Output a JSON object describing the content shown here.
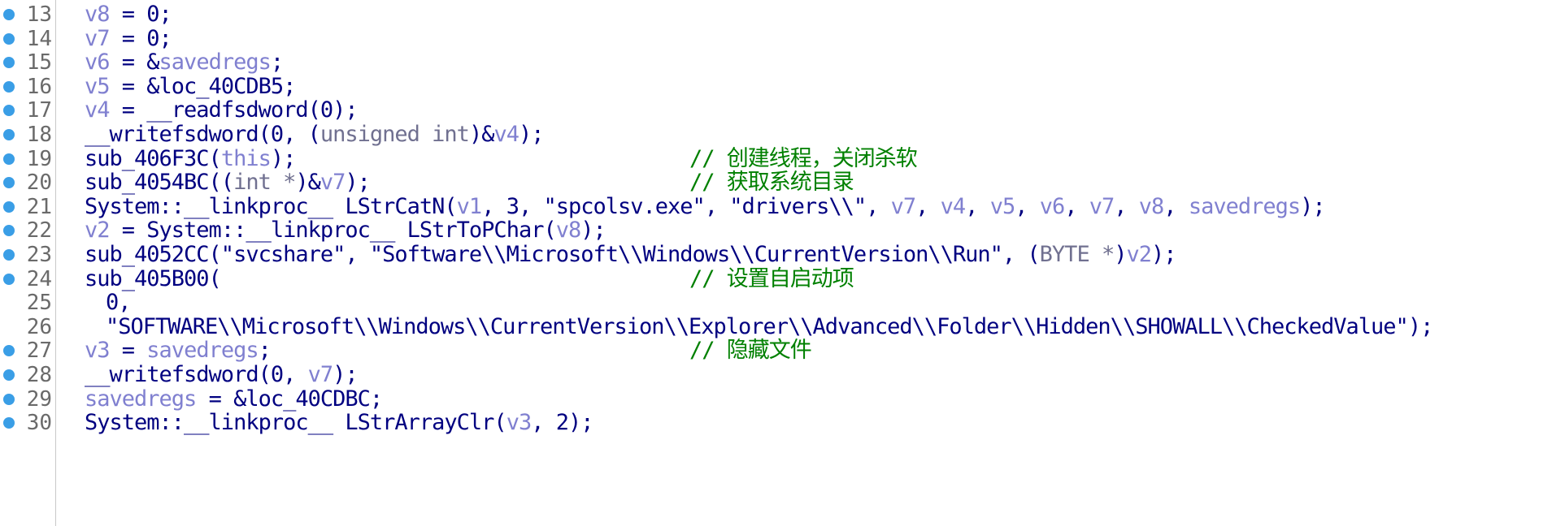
{
  "editor": {
    "lines": [
      {
        "num": "13",
        "bp": true,
        "indent": 0,
        "tokens": [
          [
            "v",
            "v8"
          ],
          [
            "n",
            " = 0;"
          ]
        ],
        "comment": ""
      },
      {
        "num": "14",
        "bp": true,
        "indent": 0,
        "tokens": [
          [
            "v",
            "v7"
          ],
          [
            "n",
            " = 0;"
          ]
        ],
        "comment": ""
      },
      {
        "num": "15",
        "bp": true,
        "indent": 0,
        "tokens": [
          [
            "v",
            "v6"
          ],
          [
            "n",
            " = &"
          ],
          [
            "v",
            "savedregs"
          ],
          [
            "n",
            ";"
          ]
        ],
        "comment": ""
      },
      {
        "num": "16",
        "bp": true,
        "indent": 0,
        "tokens": [
          [
            "v",
            "v5"
          ],
          [
            "n",
            " = &loc_40CDB5;"
          ]
        ],
        "comment": ""
      },
      {
        "num": "17",
        "bp": true,
        "indent": 0,
        "tokens": [
          [
            "v",
            "v4"
          ],
          [
            "n",
            " = __readfsdword(0);"
          ]
        ],
        "comment": ""
      },
      {
        "num": "18",
        "bp": true,
        "indent": 0,
        "tokens": [
          [
            "n",
            "__writefsdword(0, ("
          ],
          [
            "k",
            "unsigned int"
          ],
          [
            "n",
            ")&"
          ],
          [
            "v",
            "v4"
          ],
          [
            "n",
            ");"
          ]
        ],
        "comment": ""
      },
      {
        "num": "19",
        "bp": true,
        "indent": 0,
        "tokens": [
          [
            "n",
            "sub_406F3C("
          ],
          [
            "v",
            "this"
          ],
          [
            "n",
            ");"
          ]
        ],
        "comment": "// 创建线程，关闭杀软"
      },
      {
        "num": "20",
        "bp": true,
        "indent": 0,
        "tokens": [
          [
            "n",
            "sub_4054BC(("
          ],
          [
            "k",
            "int *"
          ],
          [
            "n",
            ")&"
          ],
          [
            "v",
            "v7"
          ],
          [
            "n",
            ");"
          ]
        ],
        "comment": "// 获取系统目录"
      },
      {
        "num": "21",
        "bp": true,
        "indent": 0,
        "tokens": [
          [
            "n",
            "System::__linkproc__ LStrCatN("
          ],
          [
            "v",
            "v1"
          ],
          [
            "n",
            ", 3, \"spcolsv.exe\", \"drivers\\\\\", "
          ],
          [
            "v",
            "v7"
          ],
          [
            "n",
            ", "
          ],
          [
            "v",
            "v4"
          ],
          [
            "n",
            ", "
          ],
          [
            "v",
            "v5"
          ],
          [
            "n",
            ", "
          ],
          [
            "v",
            "v6"
          ],
          [
            "n",
            ", "
          ],
          [
            "v",
            "v7"
          ],
          [
            "n",
            ", "
          ],
          [
            "v",
            "v8"
          ],
          [
            "n",
            ", "
          ],
          [
            "v",
            "savedregs"
          ],
          [
            "n",
            ");"
          ]
        ],
        "comment": ""
      },
      {
        "num": "22",
        "bp": true,
        "indent": 0,
        "tokens": [
          [
            "v",
            "v2"
          ],
          [
            "n",
            " = System::__linkproc__ LStrToPChar("
          ],
          [
            "v",
            "v8"
          ],
          [
            "n",
            ");"
          ]
        ],
        "comment": ""
      },
      {
        "num": "23",
        "bp": true,
        "indent": 0,
        "tokens": [
          [
            "n",
            "sub_4052CC(\"svcshare\", \"Software\\\\Microsoft\\\\Windows\\\\CurrentVersion\\\\Run\", ("
          ],
          [
            "k",
            "BYTE *"
          ],
          [
            "n",
            ")"
          ],
          [
            "v",
            "v2"
          ],
          [
            "n",
            ");"
          ]
        ],
        "comment": ""
      },
      {
        "num": "24",
        "bp": true,
        "indent": 0,
        "tokens": [
          [
            "n",
            "sub_405B00("
          ]
        ],
        "comment": "// 设置自启动项"
      },
      {
        "num": "25",
        "bp": false,
        "indent": 1,
        "tokens": [
          [
            "n",
            "0,"
          ]
        ],
        "comment": ""
      },
      {
        "num": "26",
        "bp": false,
        "indent": 1,
        "tokens": [
          [
            "n",
            "\"SOFTWARE\\\\Microsoft\\\\Windows\\\\CurrentVersion\\\\Explorer\\\\Advanced\\\\Folder\\\\Hidden\\\\SHOWALL\\\\CheckedValue\");"
          ]
        ],
        "comment": ""
      },
      {
        "num": "27",
        "bp": true,
        "indent": 0,
        "tokens": [
          [
            "v",
            "v3"
          ],
          [
            "n",
            " = "
          ],
          [
            "v",
            "savedregs"
          ],
          [
            "n",
            ";"
          ]
        ],
        "comment": "// 隐藏文件"
      },
      {
        "num": "28",
        "bp": true,
        "indent": 0,
        "tokens": [
          [
            "n",
            "__writefsdword(0, "
          ],
          [
            "v",
            "v7"
          ],
          [
            "n",
            ");"
          ]
        ],
        "comment": ""
      },
      {
        "num": "29",
        "bp": true,
        "indent": 0,
        "tokens": [
          [
            "v",
            "savedregs"
          ],
          [
            "n",
            " = &loc_40CDBC;"
          ]
        ],
        "comment": ""
      },
      {
        "num": "30",
        "bp": true,
        "indent": 0,
        "tokens": [
          [
            "n",
            "System::__linkproc__ LStrArrayClr("
          ],
          [
            "v",
            "v3"
          ],
          [
            "n",
            ", 2);"
          ]
        ],
        "comment": ""
      }
    ]
  },
  "colors": {
    "code": "#000080",
    "variable": "#8080d0",
    "type": "#707090",
    "comment": "#008000",
    "line_number": "#6a6a6a",
    "breakpoint": "#3a9ee6"
  }
}
